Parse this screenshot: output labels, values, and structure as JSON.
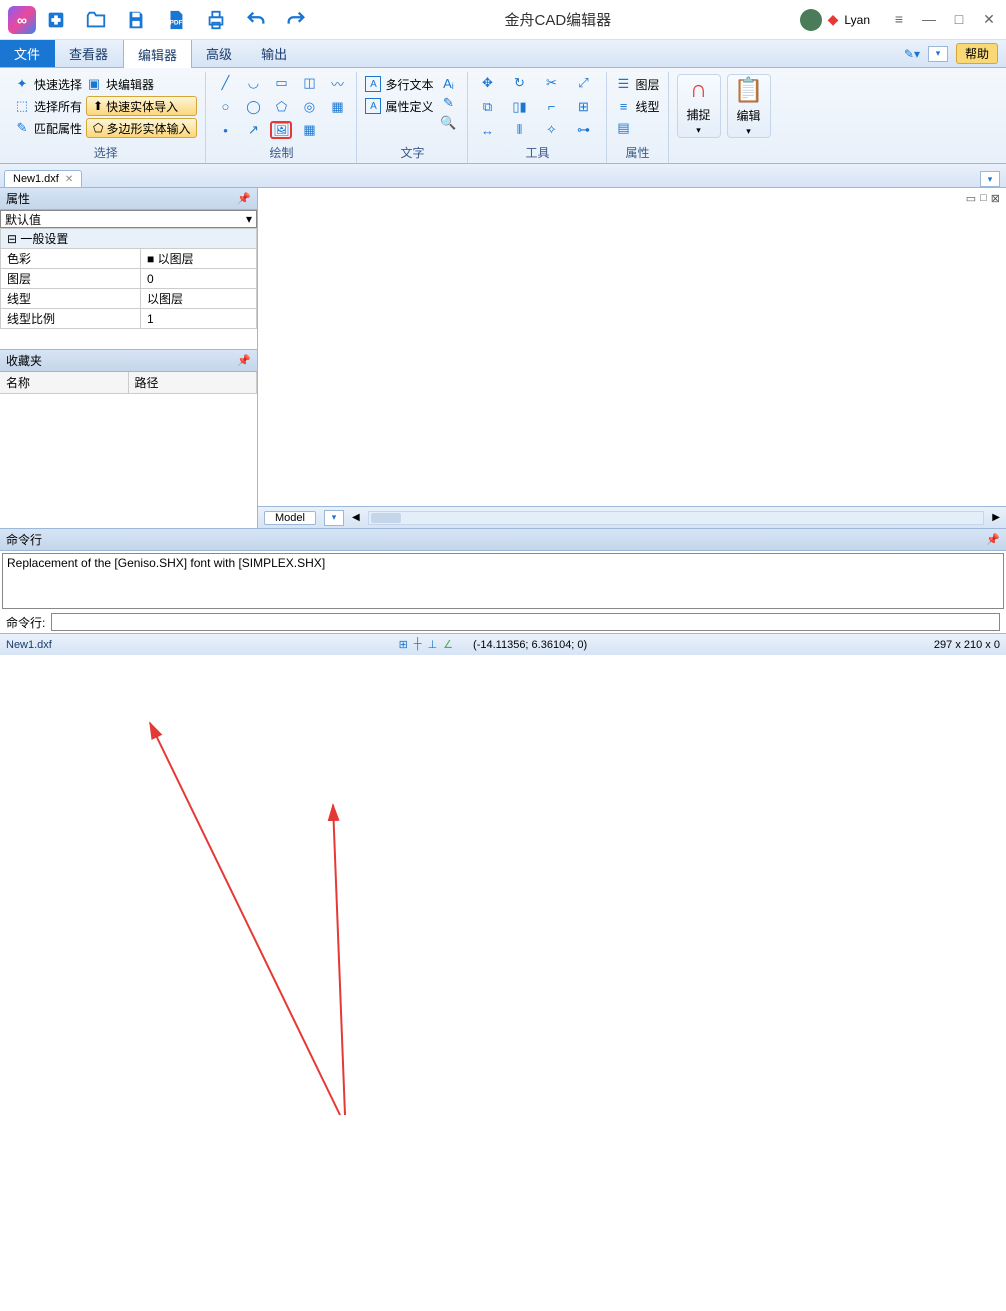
{
  "app": {
    "title": "金舟CAD编辑器",
    "user": "Lyan"
  },
  "titlebar_icons": [
    "new",
    "open",
    "save",
    "pdf",
    "print",
    "undo",
    "redo"
  ],
  "menu": {
    "file": "文件",
    "viewer": "查看器",
    "editor": "编辑器",
    "advanced": "高级",
    "output": "输出",
    "help": "帮助"
  },
  "ribbon": {
    "select": {
      "label": "选择",
      "quick_select": "快速选择",
      "select_all": "选择所有",
      "match_attr": "匹配属性",
      "block_editor": "块编辑器",
      "quick_entity_import": "快速实体导入",
      "polygon_entity_input": "多边形实体输入"
    },
    "draw": {
      "label": "绘制"
    },
    "text": {
      "label": "文字",
      "multiline": "多行文本",
      "attr_def": "属性定义"
    },
    "tools": {
      "label": "工具"
    },
    "props": {
      "label": "属性",
      "layer": "图层",
      "linetype": "线型"
    },
    "snap": {
      "label": "捕捉"
    },
    "edit": {
      "label": "编辑"
    }
  },
  "doctab": {
    "name": "New1.dxf"
  },
  "panels": {
    "props_title": "属性",
    "default_val": "默认值",
    "general": "一般设置",
    "rows": {
      "color_k": "色彩",
      "color_v": "以图层",
      "layer_k": "图层",
      "layer_v": "0",
      "ltype_k": "线型",
      "ltype_v": "以图层",
      "lscale_k": "线型比例",
      "lscale_v": "1"
    },
    "fav_title": "收藏夹",
    "fav_name": "名称",
    "fav_path": "路径"
  },
  "model_tab": "Model",
  "cmd": {
    "title": "命令行",
    "log": "Replacement of the [Geniso.SHX] font with [SIMPLEX.SHX]",
    "label": "命令行:"
  },
  "status": {
    "file": "New1.dxf",
    "coords": "(-14.11356; 6.36104; 0)",
    "dims": "297 x 210 x 0"
  }
}
